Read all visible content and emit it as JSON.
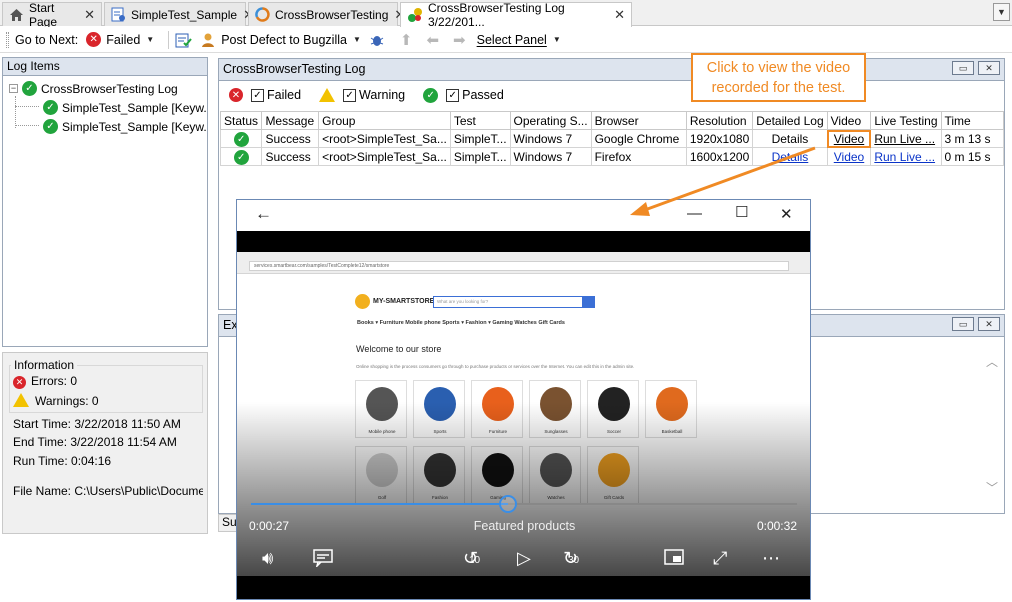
{
  "tabs": [
    {
      "label": "Start Page",
      "icon": "home-icon"
    },
    {
      "label": "SimpleTest_Sample",
      "icon": "keyword-test-icon"
    },
    {
      "label": "CrossBrowserTesting",
      "icon": "crossbrowsertesting-icon"
    },
    {
      "label": "CrossBrowserTesting Log 3/22/201...",
      "icon": "log-icon",
      "active": true
    }
  ],
  "toolbar": {
    "go_to_next": "Go to Next:",
    "failed": "Failed",
    "post_defect": "Post Defect to Bugzilla",
    "select_panel": "Select Panel"
  },
  "left_panel": {
    "title": "Log Items",
    "root": "CrossBrowserTesting Log",
    "children": [
      "SimpleTest_Sample [Keyw...",
      "SimpleTest_Sample [Keyw..."
    ]
  },
  "info": {
    "title": "Information",
    "errors": "Errors: 0",
    "warnings": "Warnings: 0",
    "start_time": "Start Time: 3/22/2018 11:50 AM",
    "end_time": "End Time: 3/22/2018 11:54 AM",
    "run_time": "Run Time: 0:04:16",
    "file_name": "File Name: C:\\Users\\Public\\Documents\\"
  },
  "main_panel": {
    "title": "CrossBrowserTesting Log",
    "filters": {
      "failed": "Failed",
      "warning": "Warning",
      "passed": "Passed"
    },
    "columns": [
      "Status",
      "Message",
      "Group",
      "Test",
      "Operating S...",
      "Browser",
      "Resolution",
      "Detailed Log",
      "Video",
      "Live Testing",
      "Time"
    ],
    "rows": [
      {
        "message": "Success",
        "group": "<root>SimpleTest_Sa...",
        "test": "SimpleT...",
        "os": "Windows 7",
        "browser": "Google Chrome",
        "resolution": "1920x1080",
        "detailed_log": "Details",
        "video": "Video",
        "live": "Run Live ...",
        "time": "3 m 13 s"
      },
      {
        "message": "Success",
        "group": "<root>SimpleTest_Sa...",
        "test": "SimpleT...",
        "os": "Windows 7",
        "browser": "Firefox",
        "resolution": "1600x1200",
        "detailed_log": "Details",
        "video": "Video",
        "live": "Run Live ...",
        "time": "0 m 15 s"
      }
    ]
  },
  "ext_panel": {
    "title": "Ext",
    "sum_tab": "Sur"
  },
  "callout": {
    "text": "Click to view the video recorded for the test."
  },
  "player": {
    "elapsed": "0:00:27",
    "duration": "0:00:32",
    "caption": "Featured products",
    "progress": 0.47,
    "skip_back": "10",
    "skip_fwd": "30",
    "site": {
      "address": "services.smartbear.com/samples/TestComplete12/smartstore",
      "logo": "MY-SMARTSTORE",
      "search_placeholder": "What are you looking for?",
      "nav": "Books ▾   Furniture   Mobile phone   Sports ▾   Fashion ▾   Gaming   Watches   Gift Cards",
      "heading": "Welcome to our store",
      "intro": "Online shopping is the process consumers go through to purchase products or services over the Internet. You can edit this in the admin site.",
      "products": [
        {
          "label": "Mobile phone",
          "color": "#555"
        },
        {
          "label": "Sports",
          "color": "#2a5fb0"
        },
        {
          "label": "Furniture",
          "color": "#e8601c"
        },
        {
          "label": "Sunglasses",
          "color": "#7a5230"
        },
        {
          "label": "Soccer",
          "color": "#222"
        },
        {
          "label": "Basketball",
          "color": "#e06a1e"
        },
        {
          "label": "Golf",
          "color": "#cfcfcf"
        },
        {
          "label": "Fashion",
          "color": "#333"
        },
        {
          "label": "Gaming",
          "color": "#111"
        },
        {
          "label": "Watches",
          "color": "#555"
        },
        {
          "label": "Gift Cards",
          "color": "#f0a020"
        }
      ]
    }
  },
  "colors": {
    "accent": "#f08a24",
    "ok": "#21a43d",
    "error": "#d9252b",
    "link": "#0a34c8",
    "panel_header": "#dde4ee"
  }
}
